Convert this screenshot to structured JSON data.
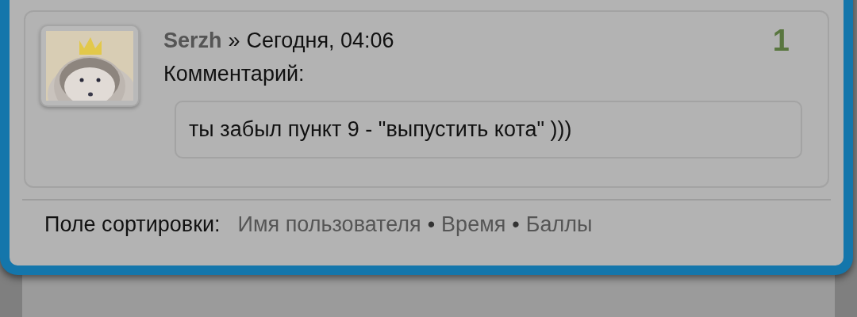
{
  "comment": {
    "author": "Serzh",
    "separator": "»",
    "time": "Сегодня, 04:06",
    "score": "1",
    "label": "Комментарий:",
    "quote": "ты забыл пункт 9 - \"выпустить кота\" )))"
  },
  "sort": {
    "label": "Поле сортировки:",
    "options": [
      "Имя пользователя",
      "Время",
      "Баллы"
    ],
    "separator": "•"
  }
}
